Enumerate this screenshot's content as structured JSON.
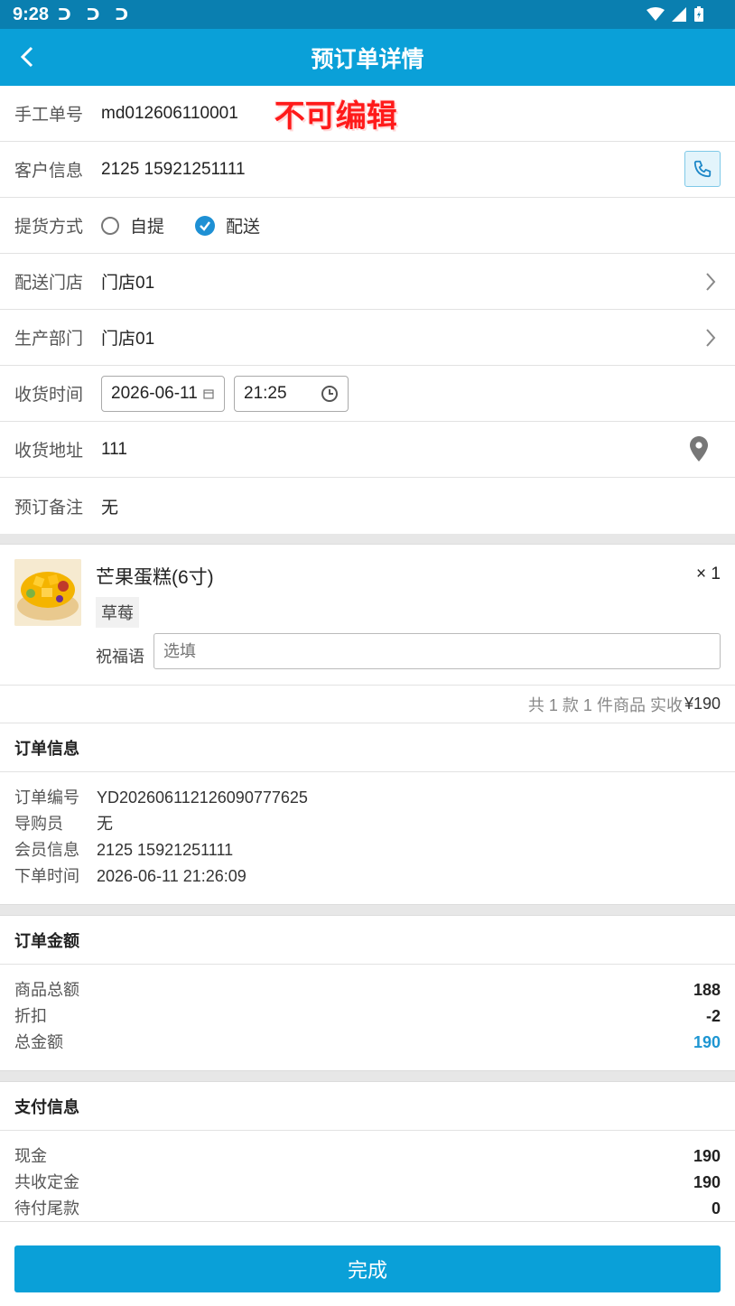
{
  "status_bar": {
    "time": "9:28",
    "notification_icons": "ᑐ ᑐ ᑐ"
  },
  "header": {
    "title": "预订单详情"
  },
  "form": {
    "manual_no": {
      "label": "手工单号",
      "value": "md012606110001",
      "note": "不可编辑"
    },
    "customer": {
      "label": "客户信息",
      "value": "2125 15921251111"
    },
    "pickup": {
      "label": "提货方式",
      "options": [
        {
          "label": "自提",
          "selected": false
        },
        {
          "label": "配送",
          "selected": true
        }
      ]
    },
    "delivery_store": {
      "label": "配送门店",
      "value": "门店01"
    },
    "production_dept": {
      "label": "生产部门",
      "value": "门店01"
    },
    "receive_time": {
      "label": "收货时间",
      "date": "2026-06-11",
      "time": "21:25"
    },
    "address": {
      "label": "收货地址",
      "value": "111"
    },
    "remark": {
      "label": "预订备注",
      "value": "无"
    }
  },
  "product": {
    "name": "芒果蛋糕(6寸)",
    "quantity": "× 1",
    "spec": "草莓",
    "blessing_label": "祝福语",
    "blessing_placeholder": "选填"
  },
  "summary": {
    "text": "共 1 款 1 件商品 实收",
    "price": "¥190"
  },
  "order_info": {
    "title": "订单信息",
    "rows": [
      {
        "k": "订单编号",
        "v": "YD202606112126090777625"
      },
      {
        "k": "导购员",
        "v": "无"
      },
      {
        "k": "会员信息",
        "v": "2125 15921251111"
      },
      {
        "k": "下单时间",
        "v": "2026-06-11 21:26:09"
      }
    ]
  },
  "order_amount": {
    "title": "订单金额",
    "rows": [
      {
        "k": "商品总额",
        "v": "188"
      },
      {
        "k": "折扣",
        "v": "-2"
      },
      {
        "k": "总金额",
        "v": "190"
      }
    ]
  },
  "payment_info": {
    "title": "支付信息",
    "rows": [
      {
        "k": "现金",
        "v": "190"
      },
      {
        "k": "共收定金",
        "v": "190"
      },
      {
        "k": "待付尾款",
        "v": "0"
      }
    ]
  },
  "footer": {
    "done_label": "完成"
  },
  "colors": {
    "accent": "#0aa0d8",
    "status_bar": "#0a7fb0",
    "note_red": "#ff1a1a"
  }
}
